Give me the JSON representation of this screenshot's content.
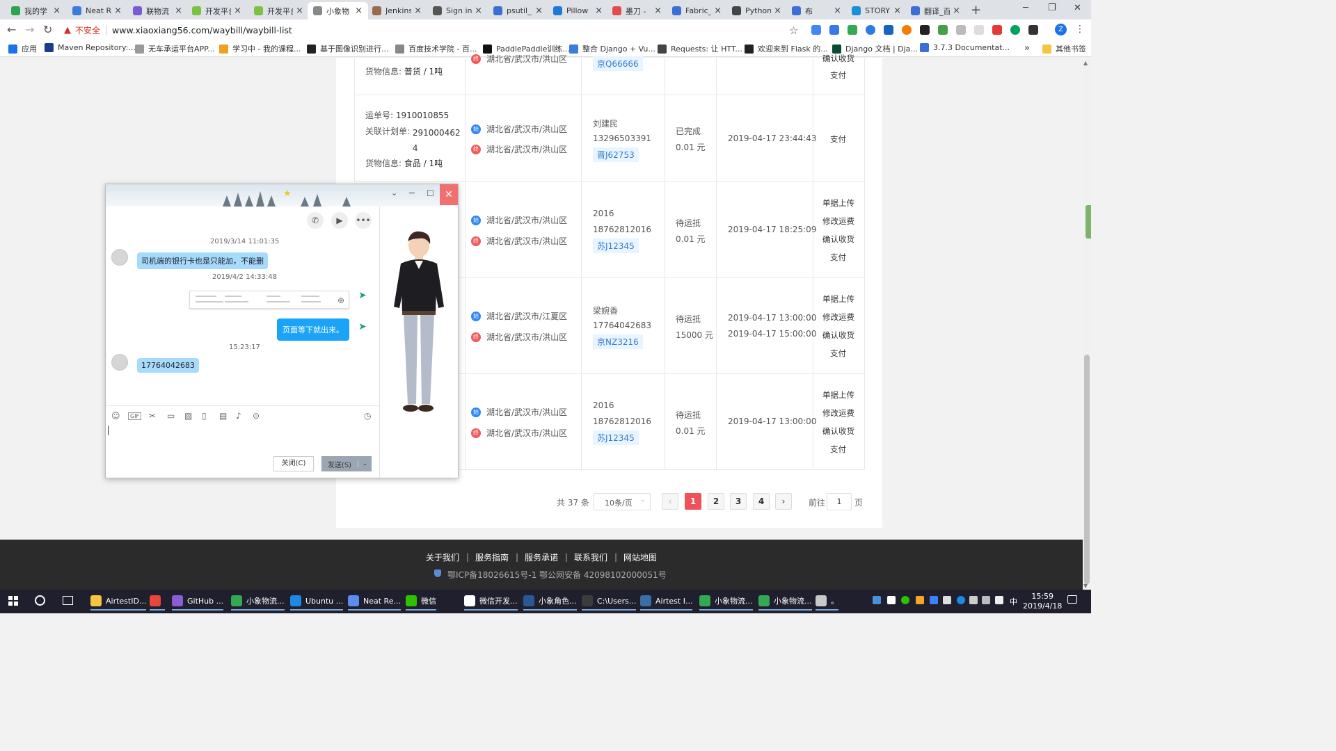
{
  "browser": {
    "tabs": [
      {
        "title": "我的学",
        "color": "#2ea44f"
      },
      {
        "title": "Neat R",
        "color": "#3b7ddd"
      },
      {
        "title": "联物流",
        "color": "#7b5cd6"
      },
      {
        "title": "开发平台",
        "color": "#7cc242"
      },
      {
        "title": "开发平台",
        "color": "#7cc242"
      },
      {
        "title": "小象物",
        "color": "#888888"
      },
      {
        "title": "Jenkins",
        "color": "#9a6b4b"
      },
      {
        "title": "Sign in",
        "color": "#555555"
      },
      {
        "title": "psutil_",
        "color": "#3b6fd6"
      },
      {
        "title": "Pillow",
        "color": "#1d7bd8"
      },
      {
        "title": "墨刀 - ",
        "color": "#e24b4b"
      },
      {
        "title": "Fabric_",
        "color": "#3b6fd6"
      },
      {
        "title": "Python",
        "color": "#444444"
      },
      {
        "title": "布",
        "color": "#3b6fd6"
      },
      {
        "title": "STORY",
        "color": "#1a8fd8"
      },
      {
        "title": "翻译_百",
        "color": "#3b6fd6"
      }
    ],
    "active_tab_index": 5,
    "security_label": "不安全",
    "url": "www.xiaoxiang56.com/waybill/waybill-list",
    "profile_letter": "Z",
    "bookmarks": [
      {
        "label": "应用",
        "color": "#1a73e8"
      },
      {
        "label": "Maven Repository:...",
        "color": "#1b3c8c"
      },
      {
        "label": "无车承运平台APP...",
        "color": "#999999"
      },
      {
        "label": "学习中 - 我的课程...",
        "color": "#f0a020"
      },
      {
        "label": "基于图像识别进行...",
        "color": "#222222"
      },
      {
        "label": "百度技术学院 - 百...",
        "color": "#888888"
      },
      {
        "label": "PaddlePaddle训练...",
        "color": "#111111"
      },
      {
        "label": "整合 Django + Vu...",
        "color": "#3b7ddd"
      },
      {
        "label": "Requests: 让 HTT...",
        "color": "#444444"
      },
      {
        "label": "欢迎来到 Flask 的...",
        "color": "#222222"
      },
      {
        "label": "Django 文档 | Dja...",
        "color": "#0c4b33"
      },
      {
        "label": "3.7.3 Documentat...",
        "color": "#3b6fd6"
      }
    ],
    "bookmarks_more": "»",
    "other_bookmarks": "其他书签"
  },
  "waybills": {
    "rows": [
      {
        "waybill_label": "运单号:",
        "waybill_no": "",
        "plan_label": "",
        "plan_no": "",
        "cargo_label": "货物信息:",
        "cargo": "普货 / 1吨",
        "from": "湖北省/武汉市/洪山区",
        "to": "",
        "driver": "",
        "phone": "",
        "plate": "京Q66666",
        "status": "",
        "price": "",
        "times": [],
        "actions": [
          "确认收货",
          "支付"
        ]
      },
      {
        "waybill_label": "运单号:",
        "waybill_no": "1910010855",
        "plan_label": "关联计划单:",
        "plan_no": "2910004624",
        "cargo_label": "货物信息:",
        "cargo": "食品 / 1吨",
        "from": "湖北省/武汉市/洪山区",
        "to": "湖北省/武汉市/洪山区",
        "driver": "刘建民",
        "phone": "13296503391",
        "plate": "晋J62753",
        "status": "已完成",
        "price": "0.01 元",
        "times": [
          "2019-04-17 23:44:43"
        ],
        "actions": [
          "支付"
        ]
      },
      {
        "from": "湖北省/武汉市/洪山区",
        "to": "湖北省/武汉市/洪山区",
        "driver": "2016",
        "phone": "18762812016",
        "plate": "苏J12345",
        "status": "待运抵",
        "price": "0.01 元",
        "times": [
          "2019-04-17 18:25:09"
        ],
        "actions": [
          "单据上传",
          "修改运费",
          "确认收货",
          "支付"
        ]
      },
      {
        "from": "湖北省/武汉市/江夏区",
        "to": "湖北省/武汉市/洪山区",
        "driver": "梁婉香",
        "phone": "17764042683",
        "plate": "京NZ3216",
        "status": "待运抵",
        "price": "15000 元",
        "times": [
          "2019-04-17 13:00:00",
          "2019-04-17 15:00:00"
        ],
        "actions": [
          "单据上传",
          "修改运费",
          "确认收货",
          "支付"
        ]
      },
      {
        "from": "湖北省/武汉市/洪山区",
        "to": "湖北省/武汉市/洪山区",
        "driver": "2016",
        "phone": "18762812016",
        "plate": "苏J12345",
        "status": "待运抵",
        "price": "0.01 元",
        "times": [
          "2019-04-17 13:00:00"
        ],
        "actions": [
          "单据上传",
          "修改运费",
          "确认收货",
          "支付"
        ]
      }
    ],
    "start_pin": "始",
    "end_pin": "终"
  },
  "pagination": {
    "total": "共 37 条",
    "page_size": "10条/页",
    "pages": [
      "1",
      "2",
      "3",
      "4"
    ],
    "current": "1",
    "prev": "‹",
    "next": "›",
    "goto_label": "前往",
    "goto_value": "1",
    "page_unit": "页"
  },
  "footer": {
    "links": [
      "关于我们",
      "服务指南",
      "服务承诺",
      "联系我们",
      "网站地图"
    ],
    "icp": "鄂ICP备18026615号-1 鄂公网安备 42098102000051号"
  },
  "chat": {
    "messages": [
      {
        "time": "2019/3/14 11:01:35",
        "text": "司机端的银行卡也是只能加，不能删"
      },
      {
        "time": "2019/4/2 14:33:48",
        "text": ""
      },
      {
        "time": "",
        "text": "页面等下就出来。"
      },
      {
        "time": "15:23:17",
        "text": "17764042683"
      }
    ],
    "close_button": "关闭(C)",
    "send_button": "发送(S)",
    "toolbar_icons": [
      "emoji-icon",
      "gif-icon",
      "screenshot-icon",
      "folder-icon",
      "image-icon",
      "shake-icon",
      "doc-icon",
      "music-icon",
      "more-icon"
    ]
  },
  "taskbar": {
    "apps": [
      {
        "label": "AirtestID...",
        "color": "#f5c542"
      },
      {
        "label": "",
        "color": "#e8463b"
      },
      {
        "label": "GitHub ...",
        "color": "#8a5cd6"
      },
      {
        "label": "小象物流...",
        "color": "#34a853"
      },
      {
        "label": "Ubuntu ...",
        "color": "#1e88e5"
      },
      {
        "label": "Neat Re...",
        "color": "#5b8def"
      },
      {
        "label": "微信",
        "color": "#2dc100"
      },
      {
        "label": "微信开发...",
        "color": "#ffffff"
      },
      {
        "label": "小象角色...",
        "color": "#2b5797"
      },
      {
        "label": "C:\\Users...",
        "color": "#3c3c3c"
      },
      {
        "label": "Airtest I...",
        "color": "#3a6ea5"
      },
      {
        "label": "小象物流...",
        "color": "#34a853"
      },
      {
        "label": "小象物流...",
        "color": "#34a853"
      },
      {
        "label": "。",
        "color": "#c8c8c8"
      }
    ],
    "ime": "中",
    "time": "15:59",
    "date": "2019/4/18"
  }
}
